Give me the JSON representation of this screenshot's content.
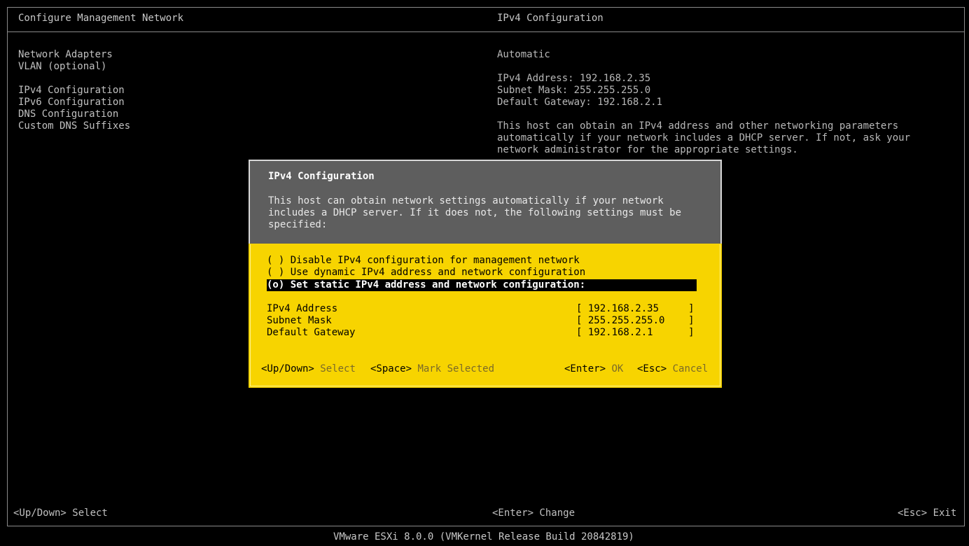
{
  "header": {
    "left_title": "Configure Management Network",
    "right_title": "IPv4 Configuration"
  },
  "menu": {
    "items": [
      "Network Adapters",
      "VLAN (optional)",
      "IPv4 Configuration",
      "IPv6 Configuration",
      "DNS Configuration",
      "Custom DNS Suffixes"
    ]
  },
  "info": {
    "mode": "Automatic",
    "ipv4_address": "IPv4 Address: 192.168.2.35",
    "subnet_mask": "Subnet Mask: 255.255.255.0",
    "default_gateway": "Default Gateway: 192.168.2.1",
    "desc_lines": [
      "This host can obtain an IPv4 address and other networking parameters",
      "automatically if your network includes a DHCP server. If not, ask your",
      "network administrator for the appropriate settings."
    ]
  },
  "dialog": {
    "title": "IPv4 Configuration",
    "desc_lines": [
      "This host can obtain network settings automatically if your network",
      "includes a DHCP server. If it does not, the following settings must be",
      "specified:"
    ],
    "options": [
      {
        "label": "( ) Disable IPv4 configuration for management network",
        "selected": false
      },
      {
        "label": "( ) Use dynamic IPv4 address and network configuration",
        "selected": false
      },
      {
        "label": "(o) Set static IPv4 address and network configuration:",
        "selected": true
      }
    ],
    "fields": [
      {
        "label": "IPv4 Address",
        "value": "[ 192.168.2.35     ]"
      },
      {
        "label": "Subnet Mask",
        "value": "[ 255.255.255.0    ]"
      },
      {
        "label": "Default Gateway",
        "value": "[ 192.168.2.1      ]"
      }
    ],
    "hints": {
      "updown_key": "<Up/Down>",
      "updown_desc": "Select",
      "space_key": "<Space>",
      "space_desc": "Mark Selected",
      "enter_key": "<Enter>",
      "enter_desc": "OK",
      "esc_key": "<Esc>",
      "esc_desc": "Cancel"
    }
  },
  "footer": {
    "left": "<Up/Down> Select",
    "center": "<Enter> Change",
    "right": "<Esc> Exit",
    "version": "VMware ESXi 8.0.0 (VMKernel Release Build 20842819)"
  },
  "colors": {
    "dialog_body": "#f7d400",
    "dialog_header": "#5e5e5e",
    "background": "#000000"
  }
}
